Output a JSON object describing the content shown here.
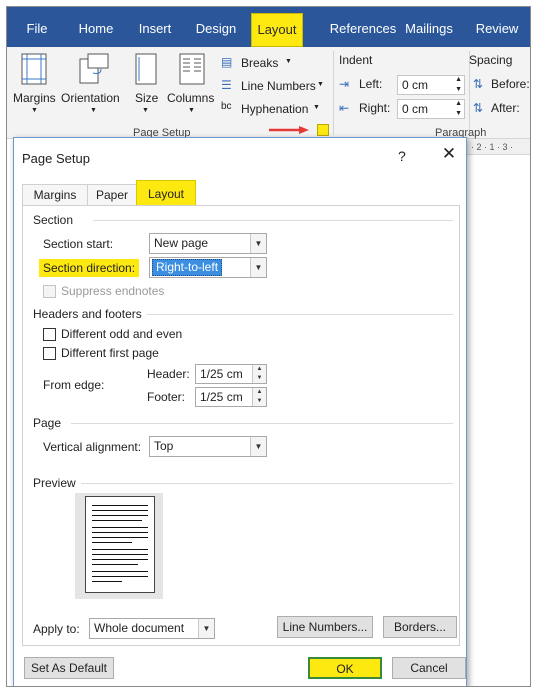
{
  "ribbon": {
    "tabs": [
      "File",
      "Home",
      "Insert",
      "Design",
      "Layout",
      "References",
      "Mailings",
      "Review"
    ],
    "active_tab": "Layout",
    "buttons": {
      "margins": "Margins",
      "orientation": "Orientation",
      "size": "Size",
      "columns": "Columns",
      "breaks": "Breaks",
      "line_numbers": "Line Numbers",
      "hyphenation": "Hyphenation"
    },
    "page_setup_group": "Page Setup",
    "indent": {
      "heading": "Indent",
      "left_label": "Left:",
      "left_value": "0 cm",
      "right_label": "Right:",
      "right_value": "0 cm"
    },
    "spacing": {
      "heading": "Spacing",
      "before_label": "Before:",
      "after_label": "After:"
    },
    "paragraph_group": "Paragraph",
    "ruler_text": "· 2 · 1 · 3 ·",
    "highlight_color": "#fde810",
    "tab_color": "#2b579a"
  },
  "dialog": {
    "title": "Page Setup",
    "help": "?",
    "close": "✕",
    "tabs": [
      "Margins",
      "Paper",
      "Layout"
    ],
    "selected_tab": "Layout",
    "section": {
      "heading": "Section",
      "start_label": "Section start:",
      "start_value": "New page",
      "direction_label": "Section direction:",
      "direction_value": "Right-to-left",
      "suppress_endnotes": "Suppress endnotes"
    },
    "headers_footers": {
      "heading": "Headers and footers",
      "odd_even": "Different odd and even",
      "first_page": "Different first page",
      "from_edge": "From edge:",
      "header_label": "Header:",
      "header_value": "1/25 cm",
      "footer_label": "Footer:",
      "footer_value": "1/25 cm"
    },
    "page": {
      "heading": "Page",
      "valign_label": "Vertical alignment:",
      "valign_value": "Top"
    },
    "preview": {
      "heading": "Preview"
    },
    "apply_to_label": "Apply to:",
    "apply_to_value": "Whole document",
    "line_numbers_button": "Line Numbers...",
    "borders_button": "Borders...",
    "set_default_button": "Set As Default",
    "ok_button": "OK",
    "cancel_button": "Cancel"
  }
}
